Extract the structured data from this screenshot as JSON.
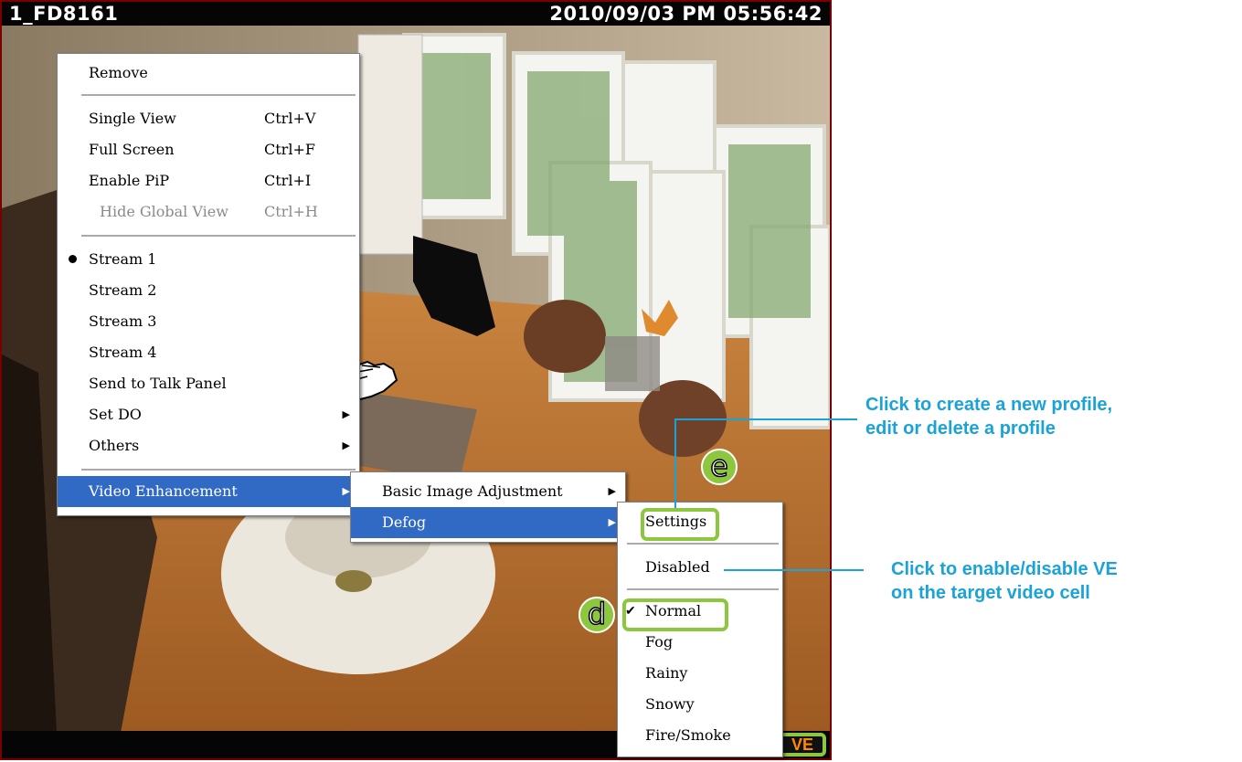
{
  "camera": {
    "name": "1_FD8161",
    "timestamp": "2010/09/03 PM 05:56:42",
    "ve_badge": "VE"
  },
  "context_menu": {
    "items": [
      {
        "label": "Remove"
      },
      {
        "label": "Single View",
        "shortcut": "Ctrl+V"
      },
      {
        "label": "Full Screen",
        "shortcut": "Ctrl+F"
      },
      {
        "label": "Enable PiP",
        "shortcut": "Ctrl+I"
      },
      {
        "label": "Hide Global View",
        "shortcut": "Ctrl+H",
        "disabled": true
      },
      {
        "label": "Stream 1",
        "selected": true
      },
      {
        "label": "Stream 2"
      },
      {
        "label": "Stream 3"
      },
      {
        "label": "Stream 4"
      },
      {
        "label": "Send to Talk Panel"
      },
      {
        "label": "Set DO"
      },
      {
        "label": "Others"
      },
      {
        "label": "Video Enhancement",
        "highlighted": true
      }
    ]
  },
  "ve_submenu": {
    "items": [
      {
        "label": "Basic Image Adjustment"
      },
      {
        "label": "Defog",
        "highlighted": true
      }
    ]
  },
  "defog_submenu": {
    "items": [
      {
        "label": "Settings"
      },
      {
        "label": "Disabled"
      },
      {
        "label": "Normal",
        "checked": true
      },
      {
        "label": "Fog"
      },
      {
        "label": "Rainy"
      },
      {
        "label": "Snowy"
      },
      {
        "label": "Fire/Smoke"
      }
    ]
  },
  "callouts": {
    "e_label": "e",
    "d_label": "d",
    "settings_note_line1": "Click to create a new profile,",
    "settings_note_line2": "edit or delete a profile",
    "disabled_note_line1": "Click to enable/disable VE",
    "disabled_note_line2": "on the target video cell"
  },
  "colors": {
    "highlight": "#316ac5",
    "callout_green": "#8dc63f",
    "annotation_blue": "#1aa3d8",
    "frame_border": "#7a0000"
  },
  "icons": [
    "hand-pointer-icon",
    "checkmark-icon",
    "submenu-arrow-icon",
    "radio-bullet-icon"
  ]
}
